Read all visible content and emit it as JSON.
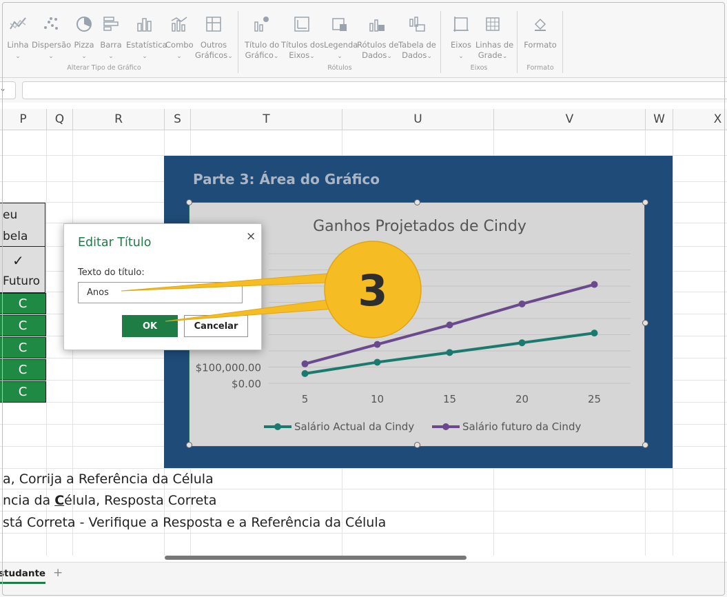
{
  "ribbon": {
    "buttons": [
      {
        "label1": "Linha",
        "label2": "",
        "icon": "line-chart-icon"
      },
      {
        "label1": "Dispersão",
        "label2": "",
        "icon": "scatter-chart-icon"
      },
      {
        "label1": "Pizza",
        "label2": "",
        "icon": "pie-chart-icon"
      },
      {
        "label1": "Barra",
        "label2": "",
        "icon": "bar-chart-icon"
      },
      {
        "label1": "Estatística",
        "label2": "",
        "icon": "statistic-chart-icon"
      },
      {
        "label1": "Combo",
        "label2": "",
        "icon": "combo-chart-icon"
      },
      {
        "label1": "Outros",
        "label2": "Gráficos",
        "icon": "other-charts-icon"
      },
      {
        "label1": "Título do",
        "label2": "Gráfico",
        "icon": "chart-title-icon"
      },
      {
        "label1": "Títulos dos",
        "label2": "Eixos",
        "icon": "axis-titles-icon"
      },
      {
        "label1": "Legenda",
        "label2": "",
        "icon": "legend-icon"
      },
      {
        "label1": "Rótulos de",
        "label2": "Dados",
        "icon": "data-labels-icon"
      },
      {
        "label1": "Tabela de",
        "label2": "Dados",
        "icon": "data-table-icon"
      },
      {
        "label1": "Eixos",
        "label2": "",
        "icon": "axes-icon"
      },
      {
        "label1": "Linhas de",
        "label2": "Grade",
        "icon": "gridlines-icon"
      },
      {
        "label1": "Formato",
        "label2": "",
        "icon": "format-icon"
      }
    ],
    "groups": {
      "chart_type": "Alterar Tipo de Gráfico",
      "labels": "Rótulos",
      "axes": "Eixos",
      "format": "Formato"
    }
  },
  "columns": [
    "P",
    "Q",
    "R",
    "S",
    "T",
    "U",
    "V",
    "W",
    "X"
  ],
  "cells": {
    "header_line1": "eu",
    "header_line2": "bela",
    "check": "✓",
    "futuro": "Futuro",
    "c_values": [
      "C",
      "C",
      "C",
      "C",
      "C"
    ]
  },
  "rows_text": [
    "a, Corrija a Referência da Célula",
    "ncia da ",
    "C",
    "élula, Resposta Correta",
    "stá Correta - Verifique a Resposta e a Referência da Célula"
  ],
  "chart_section_title": "Parte 3: Área do Gráfico",
  "chart_data": {
    "type": "line",
    "title": "Ganhos Projetados de Cindy",
    "x": [
      5,
      10,
      15,
      20,
      25
    ],
    "x_tick_labels": [
      "5",
      "10",
      "15",
      "20",
      "25"
    ],
    "y_tick_labels": [
      "$100,000.00",
      "$0.00"
    ],
    "ylim": [
      0,
      800000
    ],
    "series": [
      {
        "name": "Salário Actual da Cindy",
        "color": "#1b7a70",
        "values": [
          60000,
          130000,
          190000,
          250000,
          310000
        ]
      },
      {
        "name": "Salário futuro da Cindy",
        "color": "#6a4a8c",
        "values": [
          120000,
          240000,
          360000,
          490000,
          610000
        ]
      }
    ],
    "grid": true,
    "legend": "bottom"
  },
  "dialog": {
    "title": "Editar Título",
    "close": "×",
    "field_label": "Texto do título:",
    "value": "Anos",
    "ok": "OK",
    "cancel": "Cancelar"
  },
  "callout": {
    "number": "3",
    "color": "#f5bc23"
  },
  "sheet_tab": "Estudante",
  "sheet_tab_visible": "studante",
  "add_sheet": "+"
}
